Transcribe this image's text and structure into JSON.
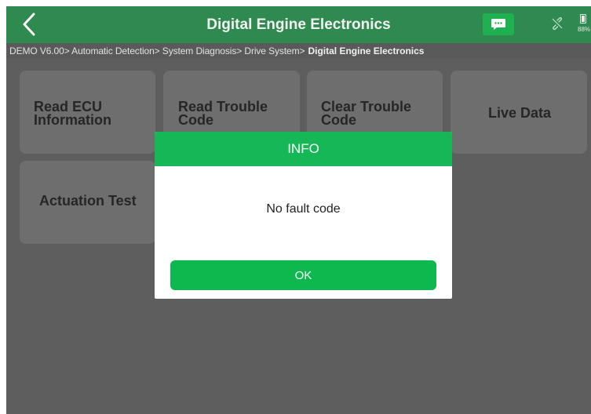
{
  "header": {
    "title": "Digital Engine Electronics",
    "back_icon": "chevron-left-icon",
    "chat_icon": "chat-bubble-icon",
    "link_icon": "unlinked-icon",
    "battery_icon": "battery-icon",
    "battery_percent": "88%"
  },
  "breadcrumb": {
    "path": "DEMO V6.00> Automatic Detection> System Diagnosis> Drive System>",
    "current": "Digital Engine Electronics"
  },
  "tiles": [
    {
      "line1": "Read ECU",
      "line2": "Information"
    },
    {
      "line1": "Read Trouble",
      "line2": "Code"
    },
    {
      "line1": "Clear Trouble",
      "line2": "Code"
    },
    {
      "label": "Live Data"
    },
    {
      "label": "Actuation Test"
    }
  ],
  "dialog": {
    "title": "INFO",
    "message": "No fault code",
    "ok_label": "OK"
  },
  "colors": {
    "header": "#2e8a4e",
    "accent": "#16b756",
    "overlay_background": "#5e5e5e",
    "tile": "#6e6e6e"
  }
}
